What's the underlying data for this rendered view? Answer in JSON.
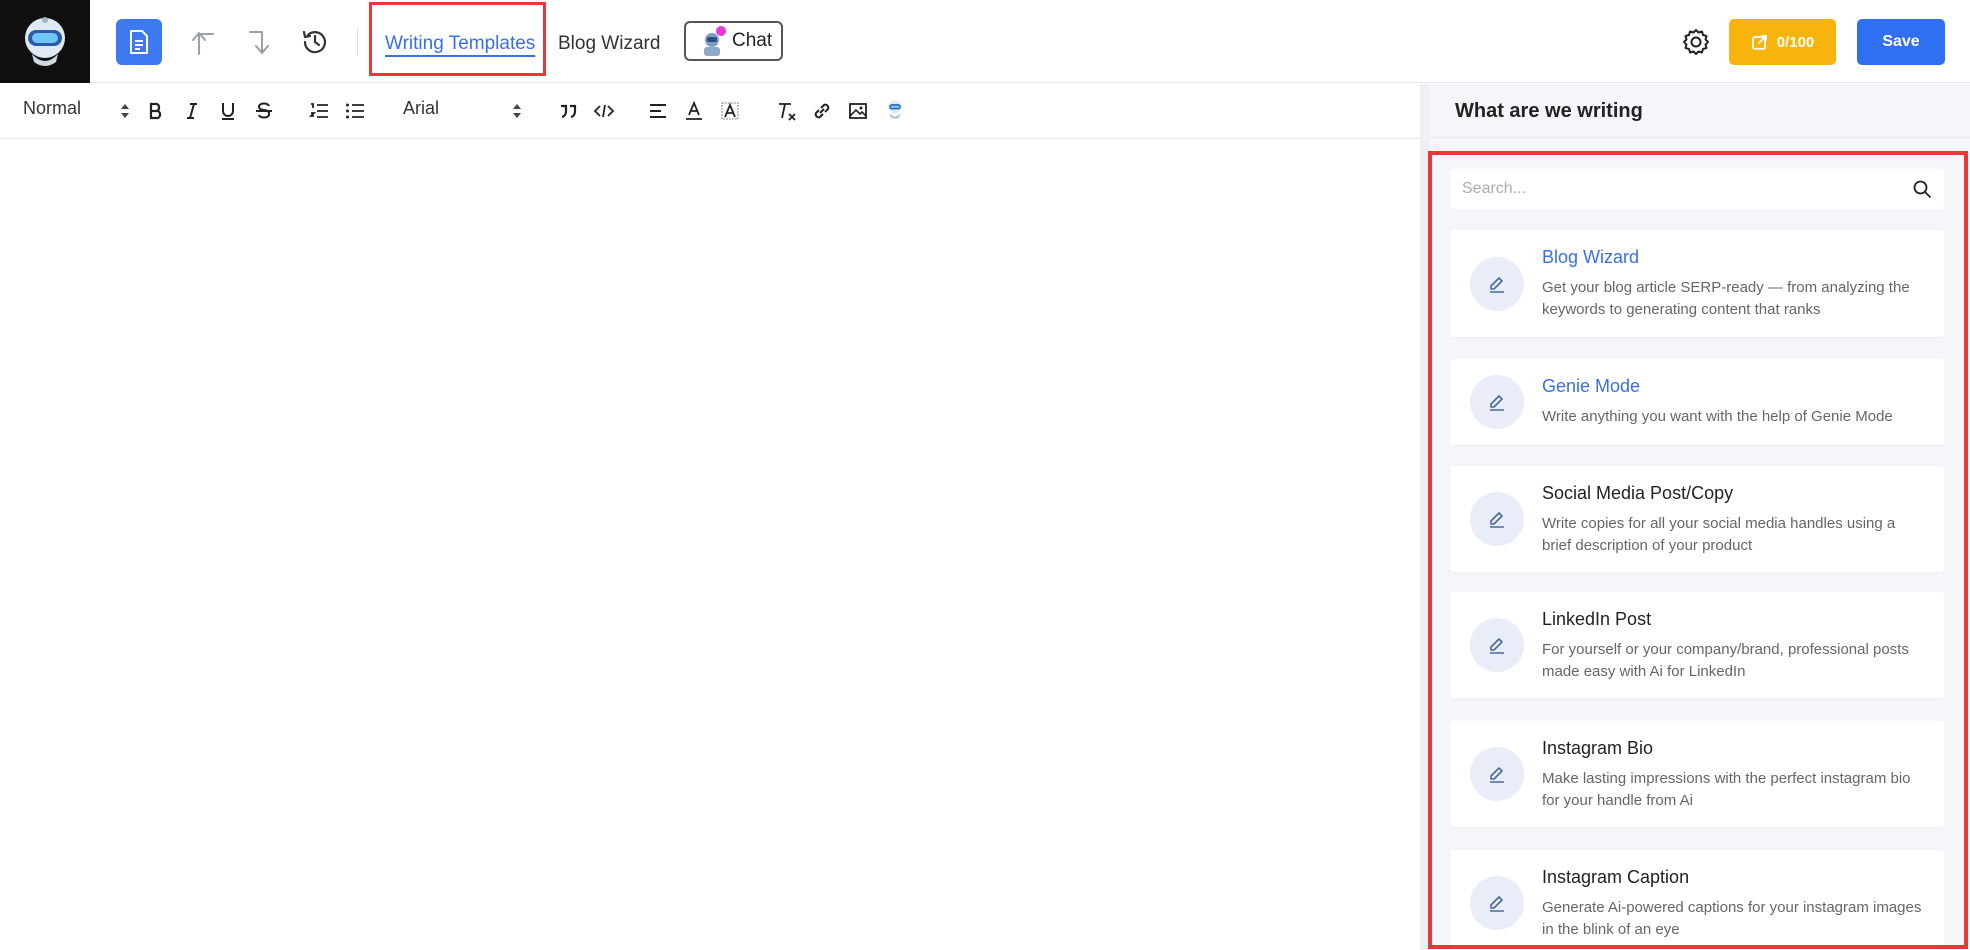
{
  "header": {
    "nav": {
      "writing_templates": "Writing Templates",
      "blog_wizard": "Blog Wizard",
      "chat": "Chat"
    },
    "credits": "0/100",
    "save": "Save"
  },
  "toolbar": {
    "style_select": "Normal",
    "font_select": "Arial"
  },
  "panel": {
    "title": "What are we writing",
    "search_placeholder": "Search...",
    "templates": [
      {
        "title": "Blog Wizard",
        "desc": "Get your blog article SERP-ready — from analyzing the keywords to generating content that ranks",
        "highlight": true
      },
      {
        "title": "Genie Mode",
        "desc": "Write anything you want with the help of Genie Mode",
        "highlight": true
      },
      {
        "title": "Social Media Post/Copy",
        "desc": "Write copies for all your social media handles using a brief description of your product",
        "highlight": false
      },
      {
        "title": "LinkedIn Post",
        "desc": "For yourself or your company/brand, professional posts made easy with Ai for LinkedIn",
        "highlight": false
      },
      {
        "title": "Instagram Bio",
        "desc": "Make lasting impressions with the perfect instagram bio for your handle from Ai",
        "highlight": false
      },
      {
        "title": "Instagram Caption",
        "desc": "Generate Ai-powered captions for your instagram images in the blink of an eye",
        "highlight": false
      }
    ]
  },
  "colors": {
    "accent": "#2f6ff0",
    "credits": "#f6b40c",
    "highlight_border": "#ee3538",
    "link": "#3a6fe3"
  }
}
